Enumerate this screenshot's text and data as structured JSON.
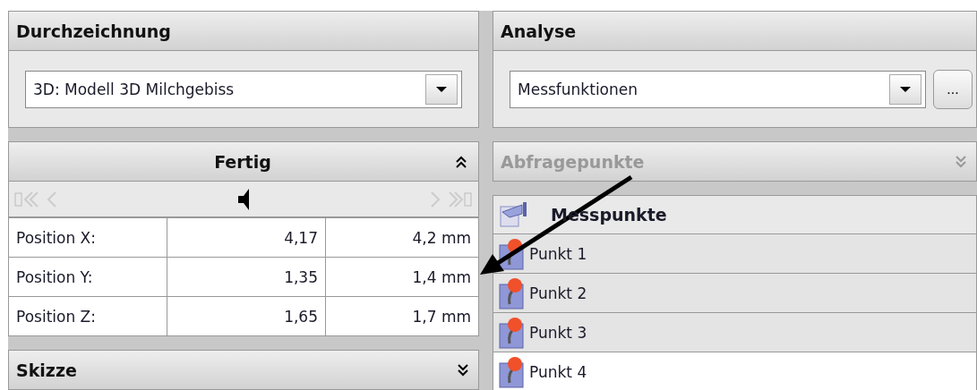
{
  "left": {
    "title": "Durchzeichnung",
    "combo": {
      "value": "3D: Modell 3D Milchgebiss"
    },
    "sections": [
      {
        "kind": "table",
        "title": "Fertig",
        "expanded": true,
        "rows": [
          {
            "label": "Position X:",
            "value": "4,17",
            "rounded": "4,2 mm"
          },
          {
            "label": "Position Y:",
            "value": "1,35",
            "rounded": "1,4 mm"
          },
          {
            "label": "Position Z:",
            "value": "1,65",
            "rounded": "1,7 mm"
          }
        ]
      },
      {
        "kind": "collapsed",
        "title": "Skizze",
        "expanded": false
      }
    ]
  },
  "right": {
    "title": "Analyse",
    "combo": {
      "value": "Messfunktionen"
    },
    "more_button": "...",
    "query": {
      "title": "Abfragepunkte",
      "expanded": false,
      "disabled": true
    },
    "list": {
      "title": "Messpunkte",
      "items": [
        {
          "label": "Punkt 1",
          "selected": false
        },
        {
          "label": "Punkt 2",
          "selected": false
        },
        {
          "label": "Punkt 3",
          "selected": false
        },
        {
          "label": "Punkt 4",
          "selected": true
        }
      ]
    }
  }
}
